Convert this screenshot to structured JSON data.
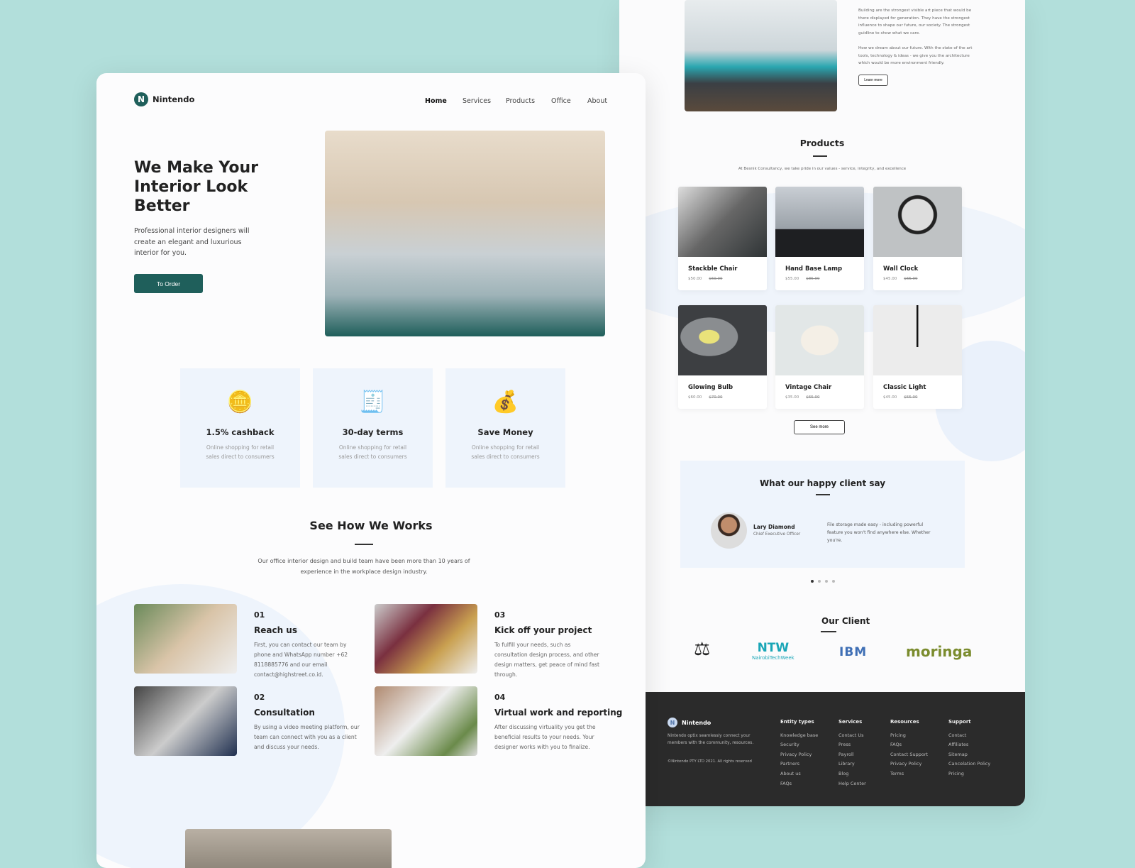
{
  "brand": {
    "name": "Nintendo",
    "initial": "N"
  },
  "nav": [
    "Home",
    "Services",
    "Products",
    "Office",
    "About"
  ],
  "hero": {
    "title": "We Make Your Interior Look Better",
    "subtitle": "Professional interior designers will create an elegant and luxurious interior for you.",
    "cta": "To Order"
  },
  "features": [
    {
      "icon": "hand-coin-icon",
      "title": "1.5% cashback",
      "desc": "Online shopping for retail sales direct to consumers"
    },
    {
      "icon": "invoice-check-icon",
      "title": "30-day terms",
      "desc": "Online shopping for retail sales direct to consumers"
    },
    {
      "icon": "money-bag-icon",
      "title": "Save Money",
      "desc": "Online shopping for retail sales direct to consumers"
    }
  ],
  "works": {
    "title": "See How We Works",
    "desc": "Our office interior design and build team have been more than 10 years of experience in the workplace design industry.",
    "steps": [
      {
        "num": "01",
        "title": "Reach us",
        "desc": "First, you can contact our team by phone and WhatsApp number +62 8118885776 and our email contact@highstreet.co.id."
      },
      {
        "num": "02",
        "title": "Consultation",
        "desc": "By using a video meeting platform, our team can connect with you as a client and discuss your needs."
      },
      {
        "num": "03",
        "title": "Kick off your project",
        "desc": "To fulfill your needs, such as consultation design process, and other design matters, get peace of mind fast through."
      },
      {
        "num": "04",
        "title": "Virtual work and reporting",
        "desc": "After discussing virtuality you get the beneficial results to your needs. Your designer works with you to finalize."
      }
    ]
  },
  "about": {
    "p1": "Building are the strongest visible art piece that would be there displayed for generation. They have the strongest influence to shape our future, our society. The strongest guidline to show what we care.",
    "p2": "How we dream about our future. With the state of the art tools, technology & ideas - we give you the architecture which would be more environment friendly.",
    "button": "Learn more"
  },
  "products": {
    "title": "Products",
    "subtitle": "At Besnik Consultancy, we take pride in our values - service, integrity, and excellence",
    "see_more": "See more",
    "items": [
      {
        "name": "Stackble Chair",
        "price": "$50.00",
        "old": "$60.00"
      },
      {
        "name": "Hand Base Lamp",
        "price": "$55.00",
        "old": "$85.00"
      },
      {
        "name": "Wall Clock",
        "price": "$45.00",
        "old": "$65.00"
      },
      {
        "name": "Glowing Bulb",
        "price": "$60.00",
        "old": "$70.00"
      },
      {
        "name": "Vintage Chair",
        "price": "$35.00",
        "old": "$65.00"
      },
      {
        "name": "Classic Light",
        "price": "$45.00",
        "old": "$55.00"
      }
    ]
  },
  "testimonial": {
    "title": "What our happy client say",
    "name": "Lary Diamond",
    "role": "Chief Executive Officer",
    "quote": "File storage made easy - including powerful feature you won't find anywhere else. Whether you're.",
    "active_dot": 1,
    "dots": 4
  },
  "clients": {
    "title": "Our Client",
    "logos": [
      "Justice scales",
      "NairobiTechWeek",
      "IBM",
      "moringa"
    ]
  },
  "footer": {
    "desc": "Nintendo optix seamlessly connect your members with the community, resources.",
    "copyright": "©Nintendo PTY LTD 2021. All rights reserved",
    "columns": [
      {
        "title": "Entity types",
        "links": [
          "Knowledge base",
          "Security",
          "Privacy Policy",
          "Partners",
          "About us",
          "FAQs"
        ]
      },
      {
        "title": "Services",
        "links": [
          "Contact Us",
          "Press",
          "Payroll",
          "Library",
          "Blog",
          "Help Center"
        ]
      },
      {
        "title": "Resources",
        "links": [
          "Pricing",
          "FAQs",
          "Contact Support",
          "Privacy Policy",
          "Terms"
        ]
      },
      {
        "title": "Support",
        "links": [
          "Contact",
          "Affiliates",
          "Sitemap",
          "Cancelation Policy",
          "Pricing"
        ]
      }
    ]
  },
  "colors": {
    "accent": "#1f5f5b",
    "background": "#b2dfdb",
    "card": "#eef4fc",
    "footer": "#2b2b2b"
  }
}
